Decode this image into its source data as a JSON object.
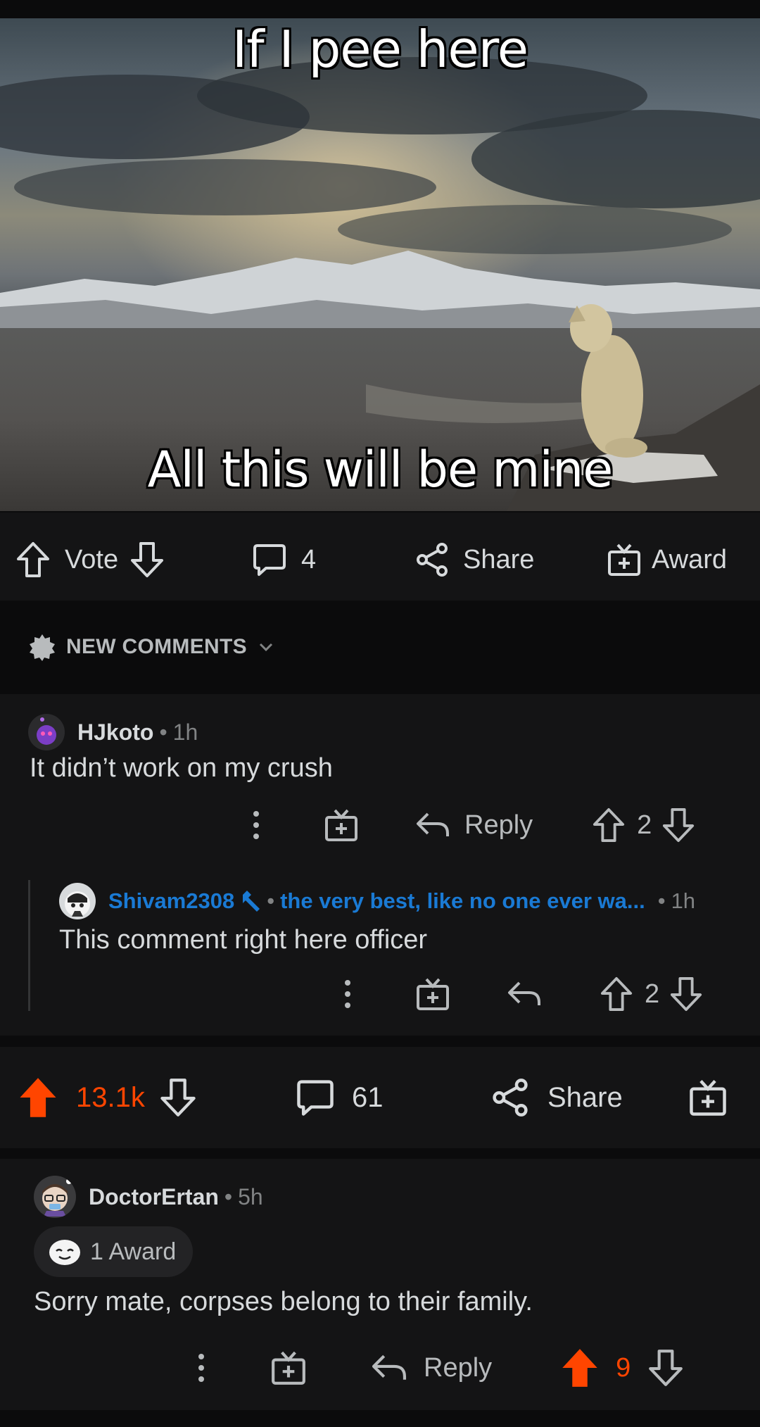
{
  "meme": {
    "caption_top": "If I pee here",
    "caption_bottom": "All this will be mine"
  },
  "post_actions": {
    "vote_label": "Vote",
    "comment_count": "4",
    "share_label": "Share",
    "award_label": "Award"
  },
  "sort": {
    "label": "NEW COMMENTS"
  },
  "comment1": {
    "user": "HJkoto",
    "time": "1h",
    "body": "It didn’t work on my crush",
    "reply_label": "Reply",
    "score": "2"
  },
  "reply1": {
    "user": "Shivam2308",
    "flair": "the very best, like no one ever wa...",
    "time": "1h",
    "body": "This comment right here officer",
    "score": "2"
  },
  "parent_actions": {
    "score": "13.1k",
    "comment_count": "61",
    "share_label": "Share"
  },
  "comment2": {
    "user": "DoctorErtan",
    "time": "5h",
    "award_text": "1 Award",
    "body": "Sorry mate, corpses belong to their family.",
    "reply_label": "Reply",
    "score": "9"
  },
  "colors": {
    "upvote": "#ff4500",
    "flair": "#1a7ad4",
    "background": "#0b0b0c",
    "card": "#141415"
  }
}
